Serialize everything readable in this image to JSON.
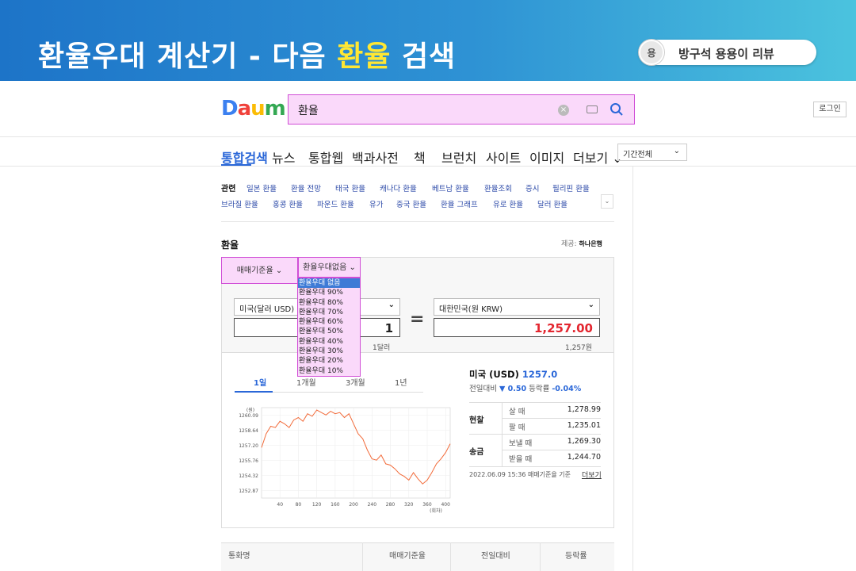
{
  "banner": {
    "title_pre": "환율우대 계산기 - 다음 ",
    "title_hl": "환율",
    "title_post": " 검색",
    "brand_icon_text": "용",
    "brand_text": "방구석 용용이 리뷰"
  },
  "header": {
    "logo": [
      "D",
      "a",
      "u",
      "m"
    ],
    "search_value": "환율",
    "login_label": "로그인"
  },
  "nav": {
    "items": [
      "통합검색",
      "뉴스",
      "통합웹",
      "백과사전",
      "책",
      "브런치",
      "사이트",
      "이미지",
      "더보기"
    ],
    "period_label": "기간전체"
  },
  "related": {
    "label": "관련",
    "row1": [
      "일본 환율",
      "환율 전망",
      "태국 환율",
      "캐나다 환율",
      "베트남 환율",
      "환율조회",
      "증시",
      "필리핀 환율"
    ],
    "row2": [
      "브라질 환율",
      "홍콩 환율",
      "파운드 환율",
      "유가",
      "중국 환율",
      "환율 그래프",
      "유로 환율",
      "달러 환율"
    ]
  },
  "exchange": {
    "title": "환율",
    "provider_label": "제공:",
    "provider_name": "하나은행",
    "tab_basis": "매매기준율",
    "tab_pref": "환율우대없음",
    "pref_options": [
      "환율우대 없음",
      "환율우대 90%",
      "환율우대 80%",
      "환율우대 70%",
      "환율우대 60%",
      "환율우대 50%",
      "환율우대 40%",
      "환율우대 30%",
      "환율우대 20%",
      "환율우대 10%"
    ],
    "from_currency": "미국(달러 USD)",
    "to_currency": "대한민국(원 KRW)",
    "from_amount": "1",
    "to_amount": "1,257.00",
    "from_sub": "1달러",
    "to_sub": "1,257원",
    "eq_symbol": "="
  },
  "period_tabs": [
    "1일",
    "1개월",
    "3개월",
    "1년"
  ],
  "rate": {
    "country": "미국 (USD)",
    "value": "1257.0",
    "prev_label": "전일대비",
    "change": "▼ 0.50",
    "change_rate_label": "등락률",
    "change_rate": "-0.04%",
    "rows": [
      {
        "group": "현찰",
        "label": "살 때",
        "value": "1,278.99"
      },
      {
        "group": "",
        "label": "팔 때",
        "value": "1,235.01"
      },
      {
        "group": "송금",
        "label": "보낼 때",
        "value": "1,269.30"
      },
      {
        "group": "",
        "label": "받을 때",
        "value": "1,244.70"
      }
    ],
    "stamp": "2022.06.09 15:36 매매기준율 기준",
    "more": "더보기"
  },
  "bottom_headers": [
    "통화명",
    "매매기준율",
    "전일대비",
    "등락률"
  ],
  "colors": {
    "accent": "#2a67d8",
    "highlight": "#fad9fa",
    "down": "#e3262f",
    "chart_line": "#f26b3a"
  },
  "chart_data": {
    "type": "line",
    "ylabel": "(원)",
    "xlabel": "(회차)",
    "y_ticks": [
      "1260.09",
      "1258.64",
      "1257.20",
      "1255.76",
      "1254.32",
      "1252.87"
    ],
    "ylim": [
      1252.87,
      1260.09
    ],
    "x_ticks": [
      "40",
      "80",
      "120",
      "160",
      "200",
      "240",
      "280",
      "320",
      "360",
      "400"
    ],
    "xlim": [
      0,
      410
    ],
    "x": [
      0,
      10,
      20,
      30,
      40,
      50,
      60,
      70,
      80,
      90,
      100,
      110,
      120,
      130,
      140,
      150,
      160,
      170,
      180,
      190,
      200,
      210,
      220,
      230,
      240,
      250,
      260,
      270,
      280,
      290,
      300,
      310,
      320,
      330,
      340,
      350,
      360,
      370,
      380,
      390,
      400,
      410
    ],
    "y": [
      1256.9,
      1258.0,
      1258.6,
      1258.5,
      1259.0,
      1258.8,
      1258.5,
      1259.1,
      1259.3,
      1259.0,
      1259.6,
      1259.4,
      1259.9,
      1259.7,
      1259.5,
      1259.8,
      1259.6,
      1259.7,
      1259.3,
      1259.6,
      1258.8,
      1258.0,
      1257.6,
      1256.7,
      1256.0,
      1255.9,
      1256.3,
      1255.6,
      1255.5,
      1255.2,
      1254.8,
      1254.6,
      1254.3,
      1254.9,
      1254.4,
      1254.0,
      1254.3,
      1254.9,
      1255.6,
      1256.0,
      1256.5,
      1257.2
    ]
  }
}
